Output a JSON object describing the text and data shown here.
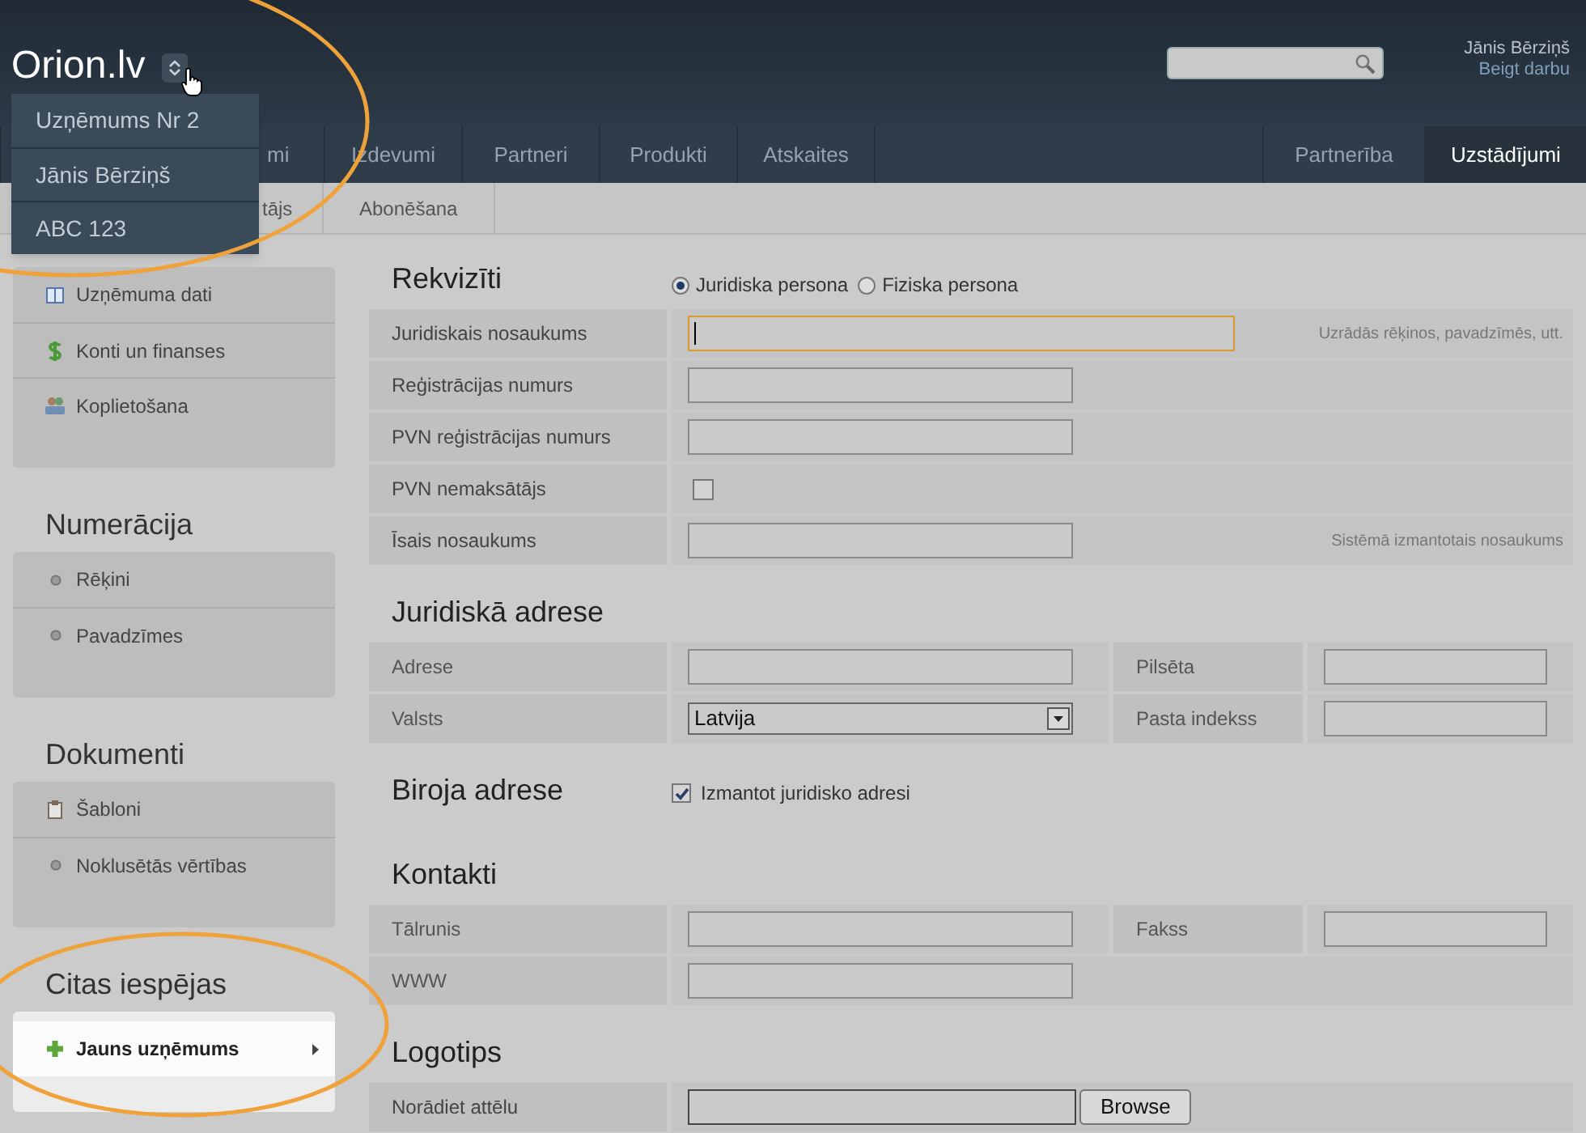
{
  "header": {
    "logo": "Orion.lv",
    "user_name": "Jānis Bērziņš",
    "logout": "Beigt darbu"
  },
  "company_menu": [
    {
      "label": "Uzņēmums Nr 2"
    },
    {
      "label": "Jānis Bērziņš"
    },
    {
      "label": "ABC 123"
    }
  ],
  "nav": {
    "left": [
      {
        "label": "mi",
        "selected": false
      },
      {
        "label": "Izdevumi",
        "selected": false
      },
      {
        "label": "Partneri",
        "selected": false
      },
      {
        "label": "Produkti",
        "selected": false
      },
      {
        "label": "Atskaites",
        "selected": false
      }
    ],
    "right": [
      {
        "label": "Partnerība",
        "selected": false
      },
      {
        "label": "Uzstādījumi",
        "selected": true
      }
    ]
  },
  "subtabs": [
    {
      "label": "tājs",
      "selected": false
    },
    {
      "label": "Abonēšana",
      "selected": false
    }
  ],
  "sidebar": [
    {
      "highlighted": false,
      "items": [
        {
          "label": "Uzņēmuma dati",
          "kind": "book"
        },
        {
          "label": "Konti un finanses",
          "kind": "dollar"
        },
        {
          "label": "Koplietošana",
          "kind": "people"
        }
      ]
    },
    {
      "title": "Numerācija",
      "highlighted": false,
      "items": [
        {
          "label": "Rēķini",
          "kind": "bullet"
        },
        {
          "label": "Pavadzīmes",
          "kind": "bullet"
        }
      ]
    },
    {
      "title": "Dokumenti",
      "highlighted": false,
      "items": [
        {
          "label": "Šabloni",
          "kind": "clipboard"
        },
        {
          "label": "Noklusētās vērtības",
          "kind": "bullet"
        }
      ]
    },
    {
      "title": "Citas iespējas",
      "highlighted": true,
      "items": [
        {
          "label": "Jauns uzņēmums",
          "kind": "plus"
        }
      ]
    }
  ],
  "sections": [
    {
      "title": "Rekvizīti",
      "person_type": [
        {
          "label": "Juridiska persona",
          "selected": true
        },
        {
          "label": "Fiziska persona",
          "selected": false
        }
      ],
      "rows": [
        {
          "items": [
            {
              "label": "Juridiskais nosaukums",
              "input": {
                "kind": "text_long",
                "focused": true
              },
              "hint": "Uzrādās rēķinos, pavadzīmēs, utt."
            }
          ]
        },
        {
          "items": [
            {
              "label": "Reģistrācijas numurs",
              "input": {
                "kind": "text",
                "focused": false
              }
            }
          ]
        },
        {
          "items": [
            {
              "label": "PVN reģistrācijas numurs",
              "input": {
                "kind": "text",
                "focused": false
              }
            }
          ]
        },
        {
          "items": [
            {
              "label": "PVN nemaksātājs",
              "input": {
                "kind": "checkbox",
                "checked": false
              }
            }
          ]
        },
        {
          "items": [
            {
              "label": "Īsais nosaukums",
              "input": {
                "kind": "text",
                "focused": false
              },
              "hint": "Sistēmā izmantotais nosaukums"
            }
          ]
        }
      ]
    },
    {
      "title": "Juridiskā adrese",
      "rows": [
        {
          "items": [
            {
              "label": "Adrese",
              "input": {
                "kind": "text",
                "focused": false
              }
            },
            {
              "label": "Pilsēta",
              "input": {
                "kind": "text",
                "focused": false
              }
            }
          ]
        },
        {
          "items": [
            {
              "label": "Valsts",
              "input": {
                "kind": "select",
                "value": "Latvija"
              }
            },
            {
              "label": "Pasta indekss",
              "input": {
                "kind": "text",
                "focused": false
              }
            }
          ]
        }
      ]
    },
    {
      "title": "Biroja adrese",
      "option": {
        "label": "Izmantot juridisko adresi",
        "checked": true
      }
    },
    {
      "title": "Kontakti",
      "rows": [
        {
          "items": [
            {
              "label": "Tālrunis",
              "input": {
                "kind": "text",
                "focused": false
              }
            },
            {
              "label": "Fakss",
              "input": {
                "kind": "text",
                "focused": false
              }
            }
          ]
        },
        {
          "items": [
            {
              "label": "WWW",
              "input": {
                "kind": "text",
                "focused": false
              }
            }
          ]
        }
      ]
    },
    {
      "title": "Logotips",
      "rows": [
        {
          "items": [
            {
              "label": "Norādiet attēlu",
              "input": {
                "kind": "file",
                "button": "Browse"
              }
            }
          ]
        }
      ]
    }
  ]
}
